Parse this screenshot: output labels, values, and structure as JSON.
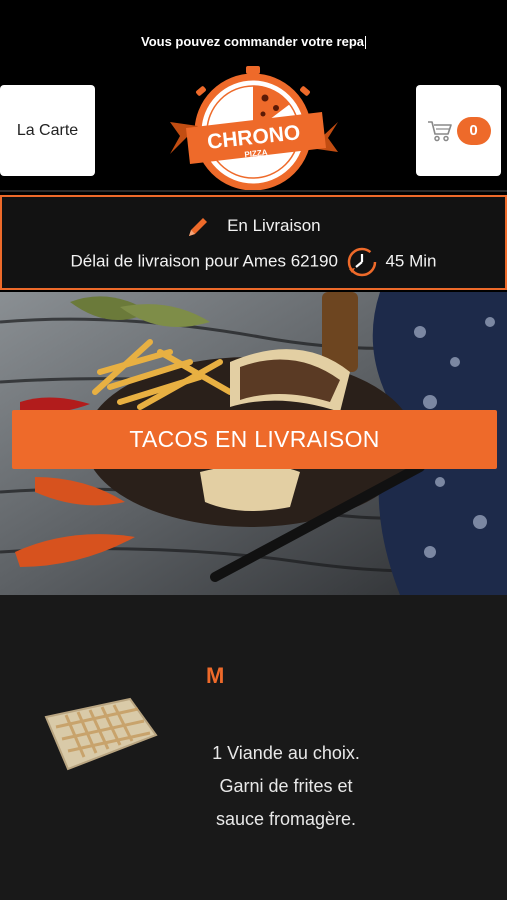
{
  "header": {
    "marquee": "Vous pouvez commander votre repa",
    "carte_label": "La Carte",
    "cart_count": "0",
    "logo_text": "CHRONO",
    "logo_subtext": "PIZZA"
  },
  "delivery": {
    "mode": "En Livraison",
    "delay_text": "Délai de livraison pour Ames 62190",
    "delay_time": "45 Min"
  },
  "hero": {
    "button_label": "TACOS EN LIVRAISON"
  },
  "menu": {
    "item": {
      "title": "M",
      "desc_line1": "1 Viande au choix.",
      "desc_line2": "Garni de frites et",
      "desc_line3": "sauce fromagère."
    }
  },
  "colors": {
    "accent": "#ee6a2a",
    "background": "#000000",
    "panel": "#191919"
  },
  "icons": [
    "pencil-icon",
    "clock-icon",
    "cart-icon"
  ]
}
